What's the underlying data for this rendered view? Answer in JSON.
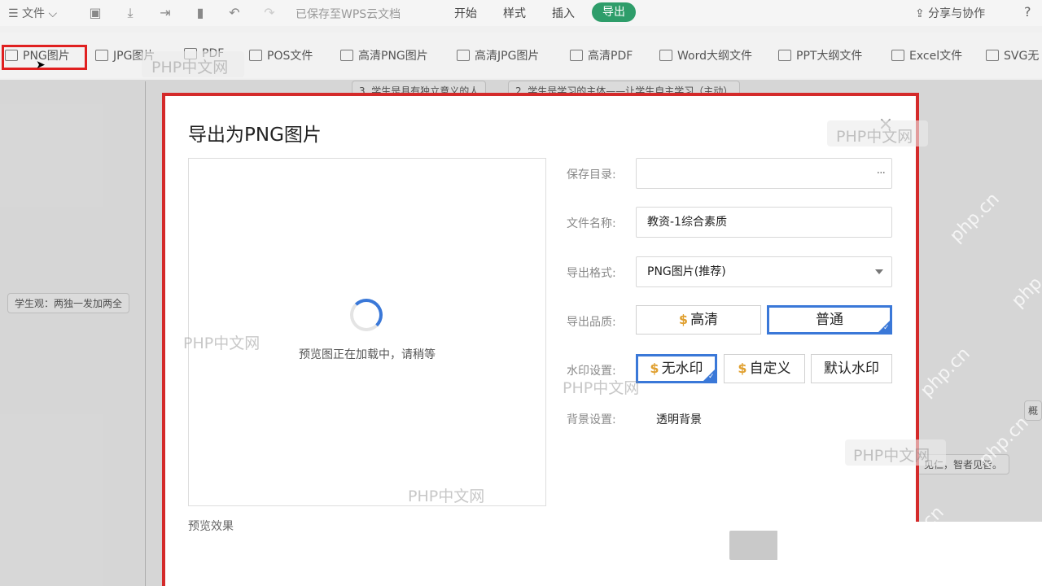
{
  "menubar": {
    "file_label": "☰ 文件 ⌵",
    "saved_status": "已保存至WPS云文档",
    "tabs": [
      "开始",
      "样式",
      "插入"
    ],
    "export_tab": "导出",
    "share_label": "⇪ 分享与协作",
    "help_label": "?",
    "accent_color": "#2e9d6a"
  },
  "toolbar": {
    "items": [
      {
        "icon": "PNG",
        "label": "PNG图片"
      },
      {
        "icon": "JPG",
        "label": "JPG图片"
      },
      {
        "icon": "PDF",
        "label": "PDF"
      },
      {
        "icon": "POS",
        "label": "POS文件"
      },
      {
        "icon": "HD",
        "label": "高清PNG图片"
      },
      {
        "icon": "HD",
        "label": "高清JPG图片"
      },
      {
        "icon": "HD",
        "label": "高清PDF"
      },
      {
        "icon": "W",
        "label": "Word大纲文件"
      },
      {
        "icon": "P",
        "label": "PPT大纲文件"
      },
      {
        "icon": "S",
        "label": "Excel文件"
      },
      {
        "icon": "SVG",
        "label": "SVG无"
      }
    ]
  },
  "mindmap": {
    "node_top_1": "3. 学生是具有独立意义的人",
    "node_top_2": "2. 学生是学习的主体——让学生自主学习（主动）",
    "node_left": "学生观：两独一发加两全",
    "node_right": "见仁，智者见智。",
    "node_edge": "概"
  },
  "dialog": {
    "title": "导出为PNG图片",
    "close_icon": "×",
    "preview_loading": "预览图正在加载中，请稍等",
    "preview_label": "预览效果",
    "save_dir_label": "保存目录:",
    "save_dir_value": "",
    "save_dir_more": "···",
    "filename_label": "文件名称:",
    "filename_value": "教资-1综合素质",
    "format_label": "导出格式:",
    "format_value": "PNG图片(推荐)",
    "quality_label": "导出品质:",
    "quality_options": [
      "高清",
      "普通"
    ],
    "quality_selected": "普通",
    "watermark_label": "水印设置:",
    "watermark_options": [
      "无水印",
      "自定义",
      "默认水印"
    ],
    "watermark_selected": "无水印",
    "background_label": "背景设置:",
    "background_value": "透明背景",
    "selected_color": "#3a78d8",
    "highlight_color": "#d42a2a"
  },
  "watermarks": {
    "cn": "PHP中文网",
    "domain": "php.cn"
  }
}
